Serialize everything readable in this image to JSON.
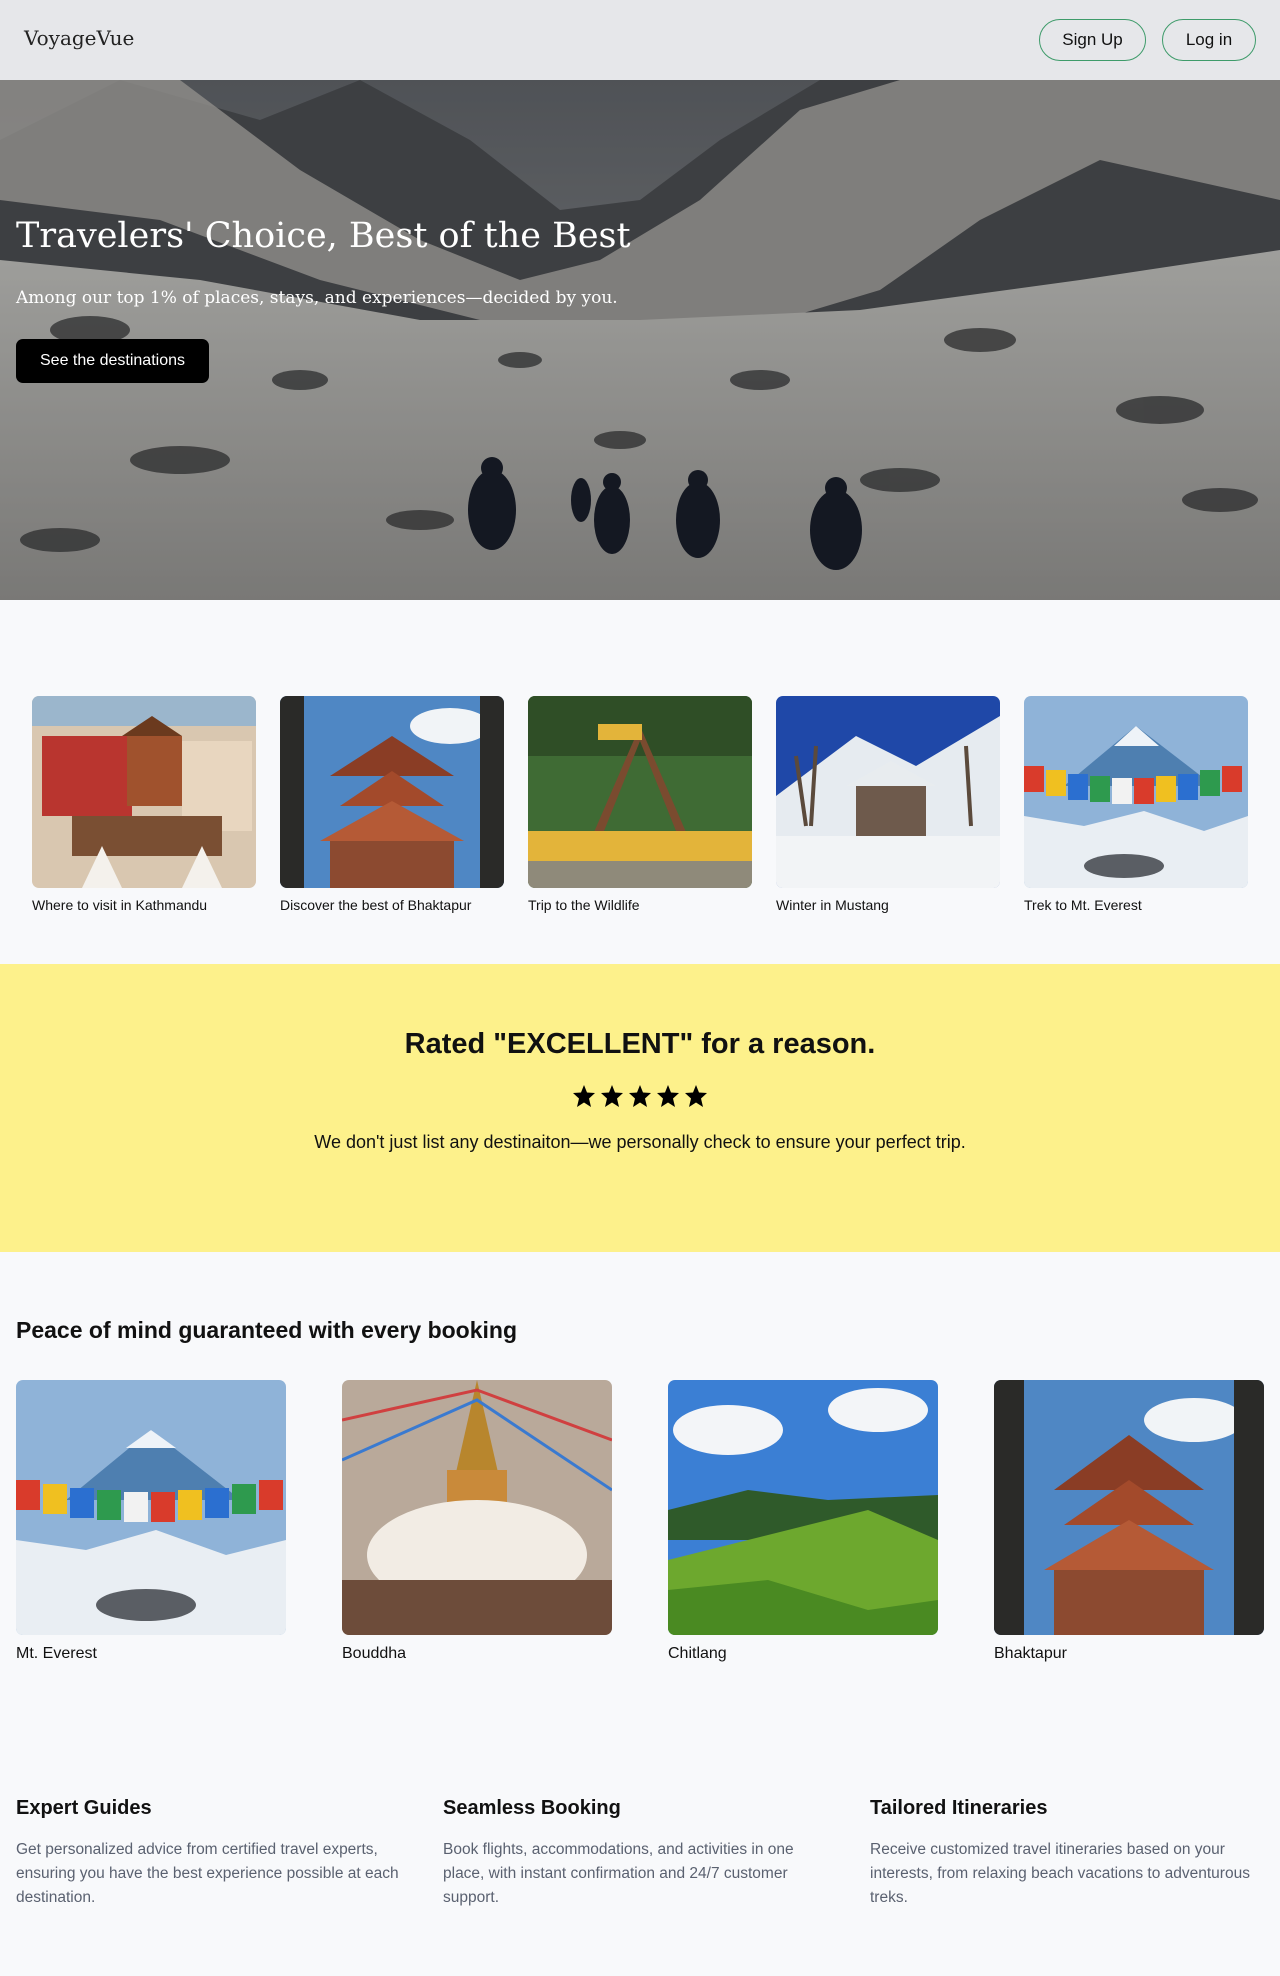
{
  "header": {
    "logo": "VoyageVue",
    "signup_label": "Sign Up",
    "login_label": "Log in"
  },
  "hero": {
    "title": "Travelers' Choice, Best of the Best",
    "subtitle": "Among our top 1% of places, stays, and experiences—decided by you.",
    "cta_label": "See the destinations"
  },
  "destinations": [
    {
      "label": "Where to visit in Kathmandu",
      "image": "kathmandu-temple-photo"
    },
    {
      "label": "Discover the best of Bhaktapur",
      "image": "bhaktapur-pagoda-photo"
    },
    {
      "label": "Trip to the Wildlife",
      "image": "national-park-sign-photo"
    },
    {
      "label": "Winter in Mustang",
      "image": "mustang-snow-monastery-photo"
    },
    {
      "label": "Trek to Mt. Everest",
      "image": "everest-prayer-flags-photo"
    }
  ],
  "rated": {
    "title": "Rated \"EXCELLENT\" for a reason.",
    "stars": 5,
    "text": "We don't just list any destinaiton—we personally check to ensure your perfect trip."
  },
  "peace": {
    "title": "Peace of mind guaranteed with every booking",
    "items": [
      {
        "label": "Mt. Everest",
        "image": "everest-prayer-flags-photo"
      },
      {
        "label": "Bouddha",
        "image": "bouddha-stupa-photo"
      },
      {
        "label": "Chitlang",
        "image": "chitlang-hills-photo"
      },
      {
        "label": "Bhaktapur",
        "image": "bhaktapur-pagoda-photo"
      }
    ]
  },
  "features": [
    {
      "title": "Expert Guides",
      "text": "Get personalized advice from certified travel experts, ensuring you have the best experience possible at each destination."
    },
    {
      "title": "Seamless Booking",
      "text": "Book flights, accommodations, and activities in one place, with instant confirmation and 24/7 customer support."
    },
    {
      "title": "Tailored Itineraries",
      "text": "Receive customized travel itineraries based on your interests, from relaxing beach vacations to adventurous treks."
    }
  ],
  "colors": {
    "header_bg": "#e6e7ea",
    "button_border": "#3e9b6a",
    "rated_bg": "#fdf18b",
    "page_bg": "#f8f9fb"
  }
}
